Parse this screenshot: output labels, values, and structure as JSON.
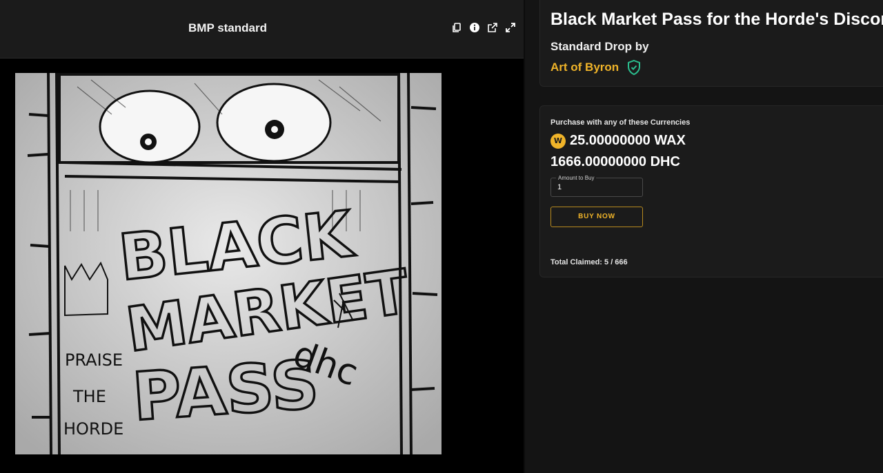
{
  "viewer": {
    "title": "BMP standard",
    "tools": [
      "copy-icon",
      "info-icon",
      "open-external-icon",
      "expand-icon"
    ]
  },
  "artwork": {
    "top_text": "BLACK",
    "mid_text": "MARKET",
    "bottom_text": "PASS",
    "side_left": [
      "PRAISE",
      "THE",
      "HORDE"
    ],
    "side_right": "dhc"
  },
  "drop": {
    "title": "Black Market Pass for the Horde's Discord",
    "subtitle": "Standard Drop by",
    "creator": "Art of Byron"
  },
  "purchase": {
    "currencies_label": "Purchase with any of these Currencies",
    "prices": [
      {
        "coin": "W",
        "value": "25.00000000 WAX"
      },
      {
        "coin": "",
        "value": "1666.00000000 DHC"
      }
    ],
    "amount_label": "Amount to Buy",
    "amount_value": "1",
    "buy_label": "BUY NOW",
    "total_claimed": "Total Claimed: 5 / 666"
  },
  "colors": {
    "accent": "#f0b429",
    "verified": "#2bbf8f",
    "panel": "#1b1b1b",
    "background": "#141414"
  }
}
